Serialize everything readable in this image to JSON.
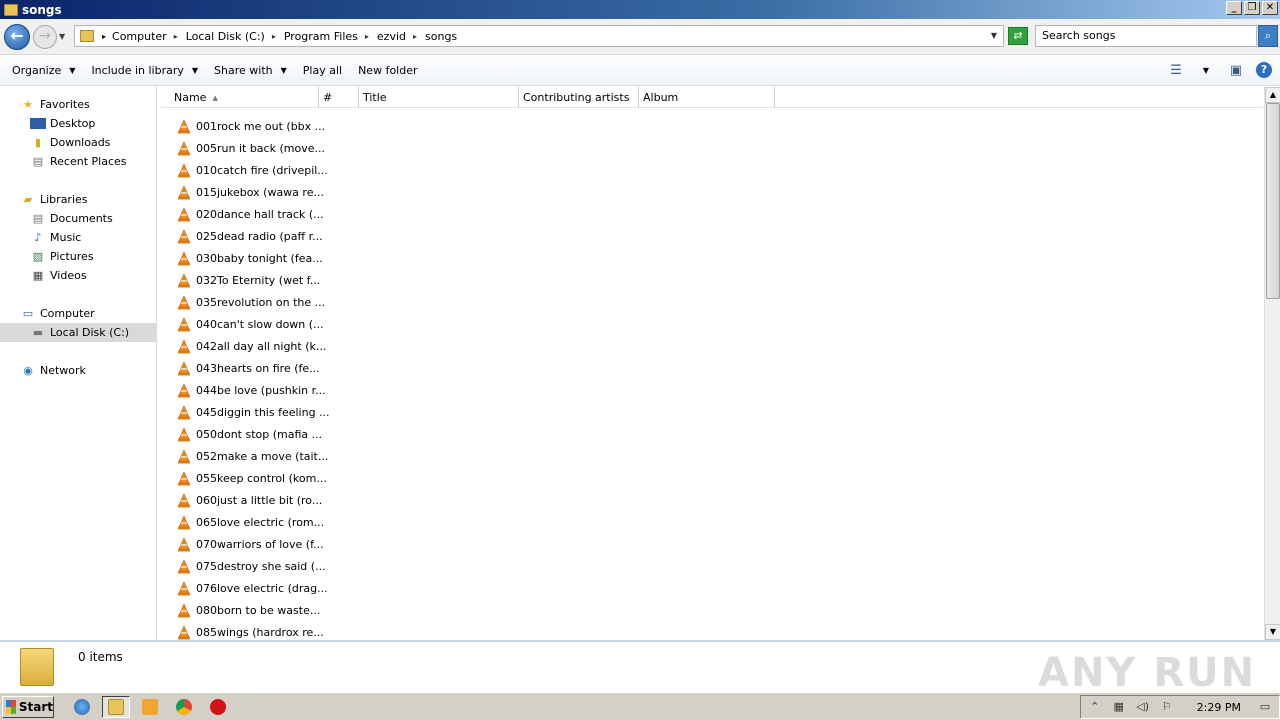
{
  "window": {
    "title": "songs"
  },
  "address": {
    "crumbs": [
      "Computer",
      "Local Disk (C:)",
      "Program Files",
      "ezvid",
      "songs"
    ],
    "search_placeholder": "Search songs"
  },
  "toolbar": {
    "organize": "Organize",
    "include_in_library": "Include in library",
    "share_with": "Share with",
    "play_all": "Play all",
    "new_folder": "New folder"
  },
  "nav": {
    "favorites": "Favorites",
    "desktop": "Desktop",
    "downloads": "Downloads",
    "recent_places": "Recent Places",
    "libraries": "Libraries",
    "documents": "Documents",
    "music": "Music",
    "pictures": "Pictures",
    "videos": "Videos",
    "computer": "Computer",
    "local_disk": "Local Disk (C:)",
    "network": "Network"
  },
  "columns": {
    "name": "Name",
    "number": "#",
    "title": "Title",
    "artists": "Contributing artists",
    "album": "Album"
  },
  "files": [
    "001rock me out (bbx ...",
    "005run it back (move...",
    "010catch fire (drivepil...",
    "015jukebox (wawa re...",
    "020dance hall track (...",
    "025dead radio (paff r...",
    "030baby tonight (fea...",
    "032To Eternity (wet f...",
    "035revolution on the ...",
    "040can't slow down (...",
    "042all day all night (k...",
    "043hearts on fire (fe...",
    "044be love (pushkin r...",
    "045diggin this feeling ...",
    "050dont stop (mafia ...",
    "052make a move (tait...",
    "055keep control (kom...",
    "060just a little bit (ro...",
    "065love electric (rom...",
    "070warriors of love (f...",
    "075destroy she said (...",
    "076love electric (drag...",
    "080born to be waste...",
    "085wings (hardrox re..."
  ],
  "details": {
    "count": "0 items"
  },
  "watermark": "ANY RUN",
  "taskbar": {
    "start": "Start",
    "clock": "2:29 PM"
  }
}
